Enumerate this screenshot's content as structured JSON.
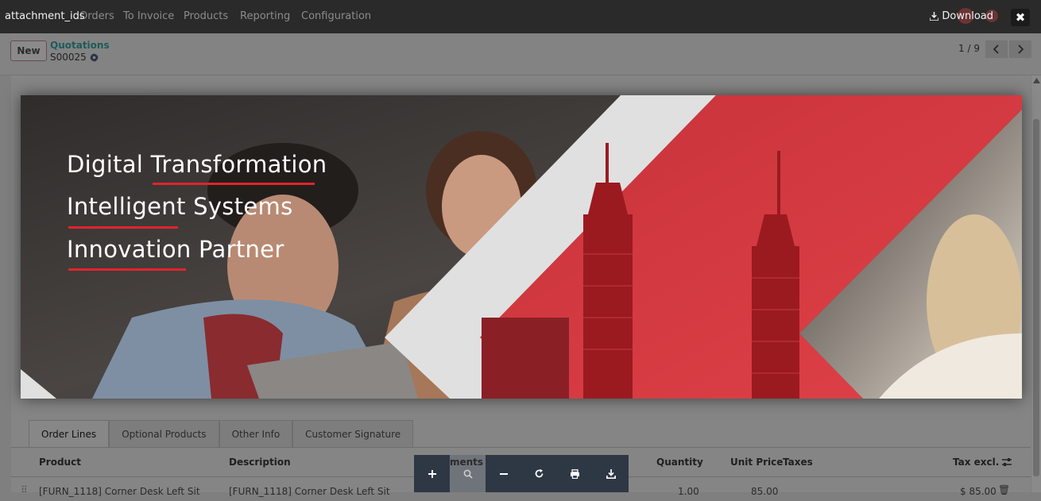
{
  "app_menu": [
    "Orders",
    "To Invoice",
    "Products",
    "Reporting",
    "Configuration"
  ],
  "viewer": {
    "title": "attachment_ids",
    "download_label": "Download",
    "close_icon": "close-icon",
    "toolbar_icons": [
      "zoom-in-icon",
      "search-icon",
      "zoom-out-icon",
      "rotate-icon",
      "print-icon",
      "download-icon"
    ]
  },
  "banner": {
    "headlines": [
      "Digital Transformation",
      "Intelligent Systems",
      "Innovation Partner"
    ],
    "accent_color": "#e0242d"
  },
  "control_panel": {
    "new_label": "New",
    "breadcrumb_parent": "Quotations",
    "record_name": "S00025",
    "pager": "1 / 9"
  },
  "tabs": [
    "Order Lines",
    "Optional Products",
    "Other Info",
    "Customer Signature"
  ],
  "table": {
    "columns": {
      "product": "Product",
      "description": "Description",
      "hidden": "ments",
      "quantity": "Quantity",
      "unit_price": "Unit Price",
      "taxes": "Taxes",
      "tax_excl": "Tax excl."
    },
    "rows": [
      {
        "product": "[FURN_1118] Corner Desk Left Sit",
        "description": "[FURN_1118] Corner Desk Left Sit",
        "quantity": "1.00",
        "unit_price": "85.00",
        "total": "$ 85.00"
      }
    ]
  }
}
